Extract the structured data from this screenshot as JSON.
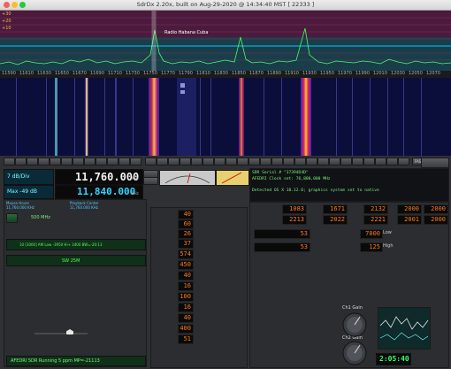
{
  "window": {
    "title": "SdrDx 2.20x, built on Aug-29-2020 @ 14:34:40 MST [ 22333 ]"
  },
  "spectrum": {
    "db_labels": [
      "+30",
      "+20",
      "+10"
    ],
    "station_label": "Radio Habana Cuba",
    "freq_ticks": [
      "11590",
      "11610",
      "11630",
      "11650",
      "11670",
      "11690",
      "11710",
      "11730",
      "11750",
      "11770",
      "11790",
      "11810",
      "11830",
      "11850",
      "11870",
      "11890",
      "11910",
      "11930",
      "11950",
      "11970",
      "11990",
      "12010",
      "12030",
      "12050",
      "12070",
      "12090"
    ]
  },
  "waterfall_right_buttons": [
    "FAS",
    "PER",
    "CTR"
  ],
  "receiver": {
    "db_per_div": "7 dB/Div",
    "max_db": "Max -49 dB",
    "vfo_freq": "11,760.000",
    "vfo_unit": "KHz",
    "second_freq": "11,840.000",
    "second_unit": "KHz",
    "mouse_hover": "Mouse Hover",
    "mouse_hover_freq": "11,760.000 KHz",
    "playback_center": "Playback Center",
    "playback_center_freq": "11,760.000 KHz",
    "band_label": "500 MHz",
    "mode_line": "10 [3000] AM Low -3950 Hi+ 3400 BW=-20:13",
    "sw_label": "SW 25M",
    "status_line": "AFEDRI SDR Running 5 ppm MP=-21113"
  },
  "console": {
    "line1": "SDR Serial #  \"37394D4D\"",
    "line2": "AFEDRI Clock set:         76,800,000 MHz",
    "line3": "Detected OS X 10.12.6; graphics system set to native"
  },
  "meters": {
    "readouts": [
      "40",
      "60",
      "26",
      "37",
      "574",
      "450",
      "40",
      "16",
      "100",
      "16",
      "40",
      "400",
      "51"
    ]
  },
  "right_readouts": {
    "row1": [
      "1083",
      "1671",
      "2132",
      "2000",
      "2000"
    ],
    "row2": [
      "2213",
      "2022",
      "2221",
      "2001",
      "2000"
    ],
    "low": "53",
    "high": "7000",
    "rf": "53",
    "hz": "125",
    "ch1_gain": "Ch1 Gain",
    "ch2_gain": "Ch2 Gain",
    "clock": "2:05:40",
    "low_label": "Low",
    "high_label": "High"
  }
}
